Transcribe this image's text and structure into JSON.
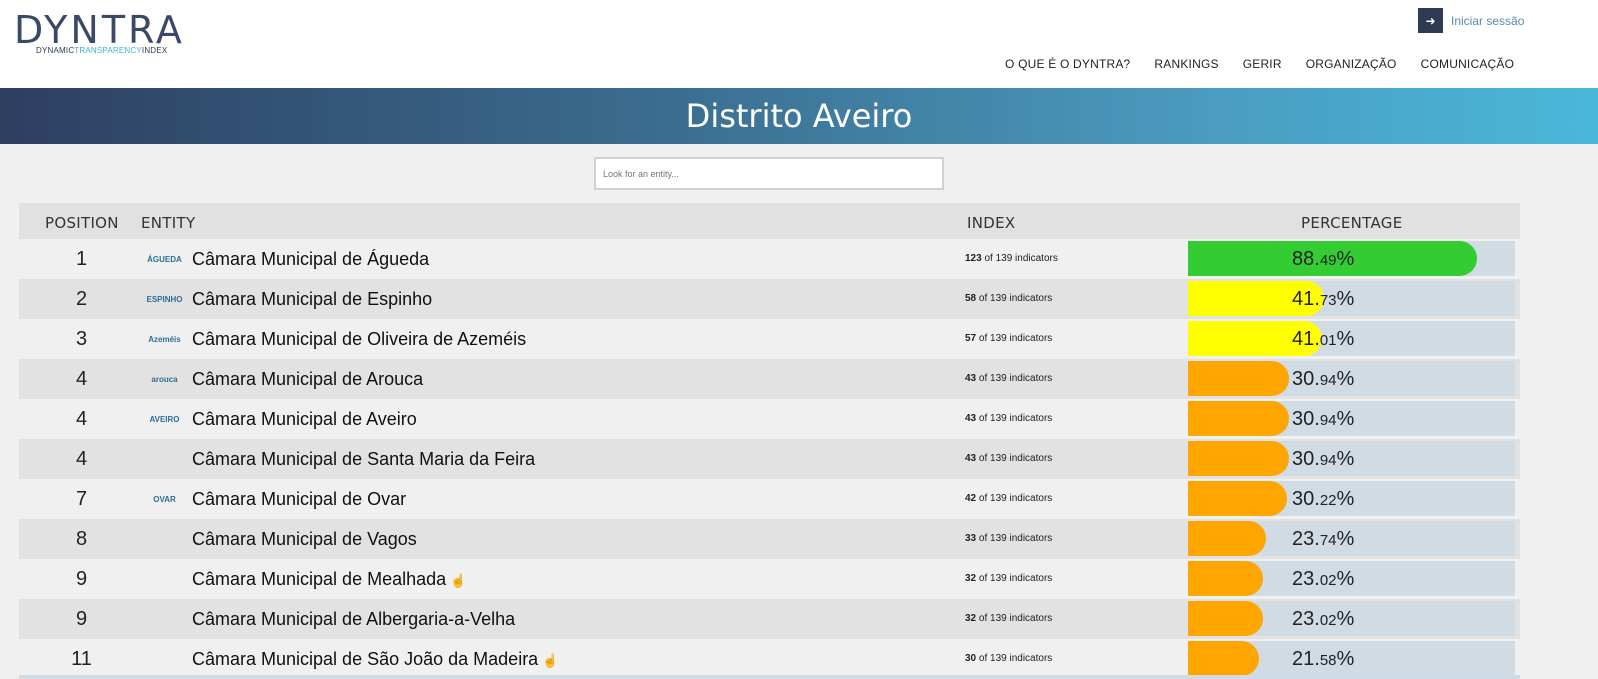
{
  "header": {
    "logo_word": "DYNTRA",
    "logo_sub_1": "DYNAMIC",
    "logo_sub_2": "TRANSPARENCY",
    "logo_sub_3": "INDEX",
    "login_label": "Iniciar sessão",
    "nav": [
      "O QUE É O DYNTRA?",
      "RANKINGS",
      "GERIR",
      "ORGANIZAÇÃO",
      "COMUNICAÇÃO"
    ]
  },
  "banner": {
    "title": "Distrito Aveiro"
  },
  "search": {
    "placeholder": "Look for an entity..."
  },
  "table": {
    "headers": {
      "position": "POSITION",
      "entity": "ENTITY",
      "index": "INDEX",
      "percentage": "PERCENTAGE"
    },
    "of_text": "of 139 indicators",
    "rows": [
      {
        "position": "1",
        "name": "Câmara Municipal de Águeda",
        "emblem": "ÁGUEDA",
        "indicators": "123",
        "pct_int": "88.",
        "pct_dec": "49",
        "fraction": 0.8849,
        "color": "#33cc33",
        "hand": false
      },
      {
        "position": "2",
        "name": "Câmara Municipal de Espinho",
        "emblem": "ESPINHO",
        "indicators": "58",
        "pct_int": "41.",
        "pct_dec": "73",
        "fraction": 0.4173,
        "color": "#ffff00",
        "hand": false
      },
      {
        "position": "3",
        "name": "Câmara Municipal de Oliveira de Azeméis",
        "emblem": "Azeméis",
        "indicators": "57",
        "pct_int": "41.",
        "pct_dec": "01",
        "fraction": 0.4101,
        "color": "#ffff00",
        "hand": false
      },
      {
        "position": "4",
        "name": "Câmara Municipal de Arouca",
        "emblem": "arouca",
        "indicators": "43",
        "pct_int": "30.",
        "pct_dec": "94",
        "fraction": 0.3094,
        "color": "#ffa500",
        "hand": false
      },
      {
        "position": "4",
        "name": "Câmara Municipal de Aveiro",
        "emblem": "AVEIRO",
        "indicators": "43",
        "pct_int": "30.",
        "pct_dec": "94",
        "fraction": 0.3094,
        "color": "#ffa500",
        "hand": false
      },
      {
        "position": "4",
        "name": "Câmara Municipal de Santa Maria da Feira",
        "emblem": "",
        "indicators": "43",
        "pct_int": "30.",
        "pct_dec": "94",
        "fraction": 0.3094,
        "color": "#ffa500",
        "hand": false
      },
      {
        "position": "7",
        "name": "Câmara Municipal de Ovar",
        "emblem": "OVAR",
        "indicators": "42",
        "pct_int": "30.",
        "pct_dec": "22",
        "fraction": 0.3022,
        "color": "#ffa500",
        "hand": false
      },
      {
        "position": "8",
        "name": "Câmara Municipal de Vagos",
        "emblem": "",
        "indicators": "33",
        "pct_int": "23.",
        "pct_dec": "74",
        "fraction": 0.2374,
        "color": "#ffa500",
        "hand": false
      },
      {
        "position": "9",
        "name": "Câmara Municipal de Mealhada",
        "emblem": "",
        "indicators": "32",
        "pct_int": "23.",
        "pct_dec": "02",
        "fraction": 0.2302,
        "color": "#ffa500",
        "hand": true
      },
      {
        "position": "9",
        "name": "Câmara Municipal de Albergaria-a-Velha",
        "emblem": "",
        "indicators": "32",
        "pct_int": "23.",
        "pct_dec": "02",
        "fraction": 0.2302,
        "color": "#ffa500",
        "hand": false
      },
      {
        "position": "11",
        "name": "Câmara Municipal de São João da Madeira",
        "emblem": "",
        "indicators": "30",
        "pct_int": "21.",
        "pct_dec": "58",
        "fraction": 0.2158,
        "color": "#ffa500",
        "hand": true
      }
    ]
  },
  "colors": {
    "banner_start": "#2e3f60",
    "banner_end": "#4ab8d9",
    "bar_bg": "#d1dbe4"
  }
}
